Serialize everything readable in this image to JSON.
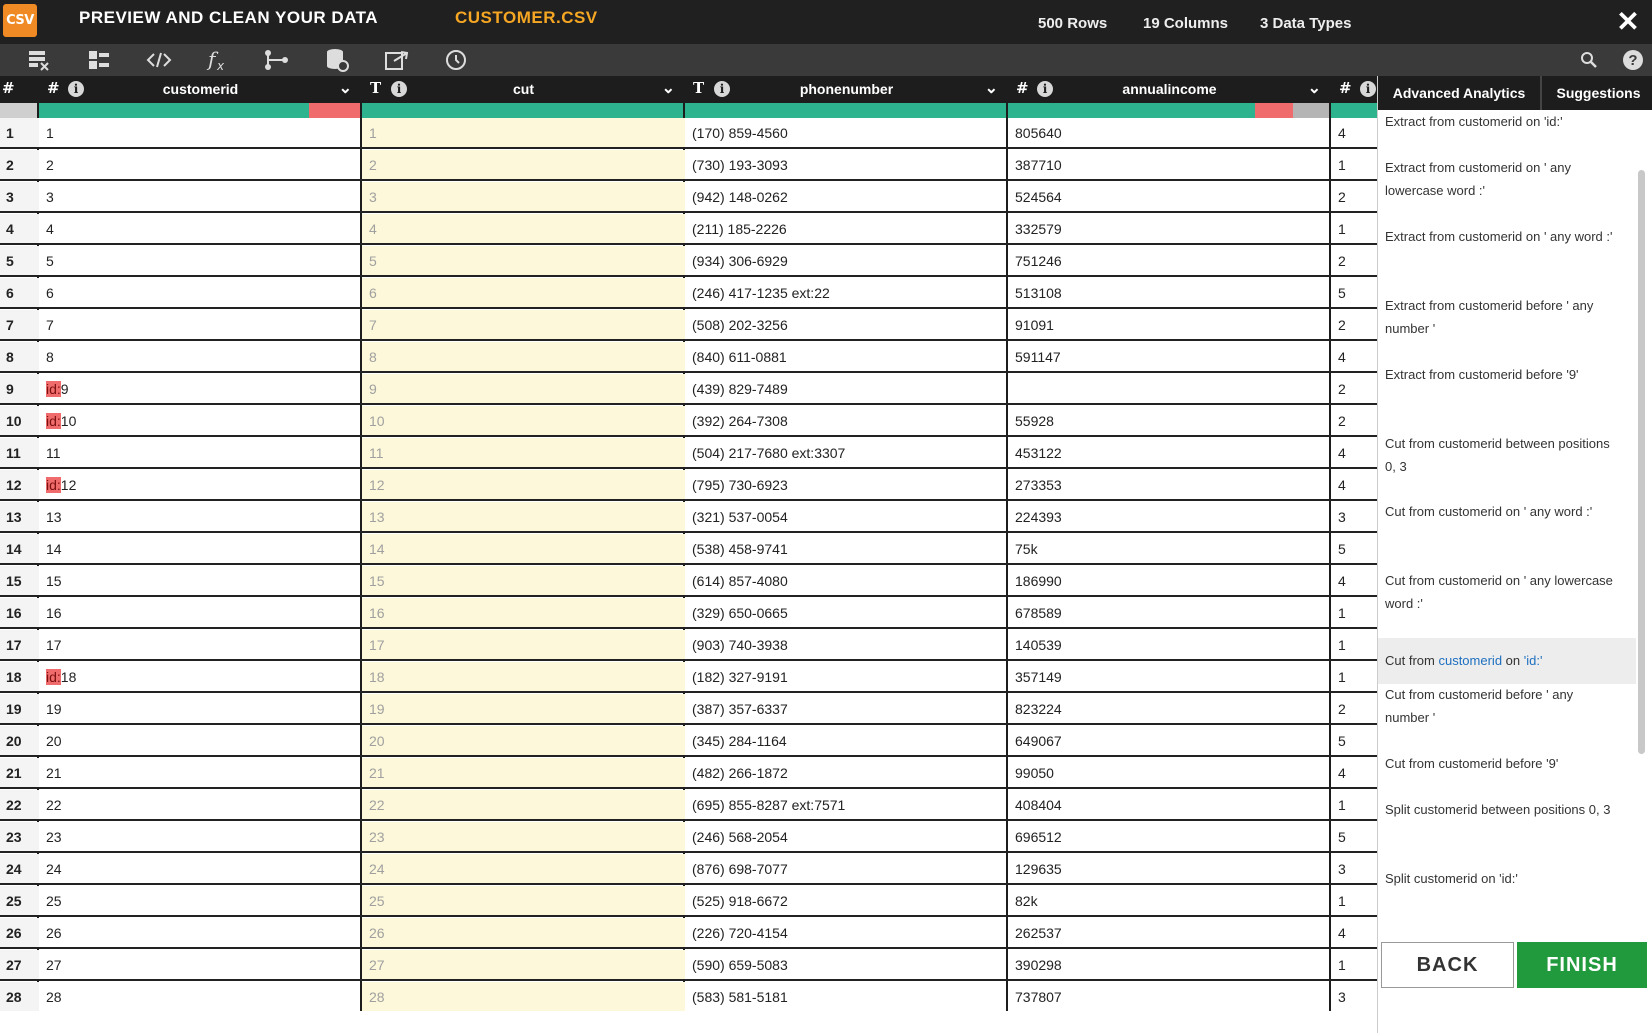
{
  "app": {
    "logo_text": "CSV",
    "title": "PREVIEW AND CLEAN YOUR DATA",
    "filename": "CUSTOMER.CSV",
    "stats": {
      "rows": "500 Rows",
      "columns": "19 Columns",
      "types": "3 Data Types"
    },
    "close_glyph": "✕"
  },
  "toolbar": {
    "icons": [
      "delete-columns-icon",
      "reorder-columns-icon",
      "code-icon",
      "formula-icon",
      "branch-icon",
      "database-icon",
      "export-icon",
      "history-icon",
      "search-icon",
      "help-icon"
    ]
  },
  "grid": {
    "rownum_header": "#",
    "columns": [
      {
        "type": "#",
        "name": "customerid",
        "info": "i",
        "chevron": "⌄"
      },
      {
        "type": "T",
        "name": "cut",
        "info": "i",
        "chevron": "⌄"
      },
      {
        "type": "T",
        "name": "phonenumber",
        "info": "i",
        "chevron": "⌄"
      },
      {
        "type": "#",
        "name": "annualincome",
        "info": "i",
        "chevron": "⌄"
      },
      {
        "type": "#",
        "name": "",
        "info": "i",
        "chevron": ""
      }
    ],
    "rows": [
      {
        "n": "1",
        "customerid": "1",
        "cut": "1",
        "phone": "(170) 859-4560",
        "income": "805640",
        "last": "4"
      },
      {
        "n": "2",
        "customerid": "2",
        "cut": "2",
        "phone": "(730) 193-3093",
        "income": "387710",
        "last": "1"
      },
      {
        "n": "3",
        "customerid": "3",
        "cut": "3",
        "phone": "(942) 148-0262",
        "income": "524564",
        "last": "2"
      },
      {
        "n": "4",
        "customerid": "4",
        "cut": "4",
        "phone": "(211) 185-2226",
        "income": "332579",
        "last": "1"
      },
      {
        "n": "5",
        "customerid": "5",
        "cut": "5",
        "phone": "(934) 306-6929",
        "income": "751246",
        "last": "2"
      },
      {
        "n": "6",
        "customerid": "6",
        "cut": "6",
        "phone": "(246) 417-1235 ext:22",
        "income": "513108",
        "last": "5"
      },
      {
        "n": "7",
        "customerid": "7",
        "cut": "7",
        "phone": "(508) 202-3256",
        "income": "91091",
        "last": "2"
      },
      {
        "n": "8",
        "customerid": "8",
        "cut": "8",
        "phone": "(840) 611-0881",
        "income": "591147",
        "last": "4"
      },
      {
        "n": "9",
        "customerid_tag": "id:",
        "customerid": "9",
        "cut": "9",
        "phone": "(439) 829-7489",
        "income": "",
        "last": "2"
      },
      {
        "n": "10",
        "customerid_tag": "id:",
        "customerid": "10",
        "cut": "10",
        "phone": "(392) 264-7308",
        "income": "55928",
        "last": "2"
      },
      {
        "n": "11",
        "customerid": "11",
        "cut": "11",
        "phone": "(504) 217-7680 ext:3307",
        "income": "453122",
        "last": "4"
      },
      {
        "n": "12",
        "customerid_tag": "id:",
        "customerid": "12",
        "cut": "12",
        "phone": "(795) 730-6923",
        "income": "273353",
        "last": "4"
      },
      {
        "n": "13",
        "customerid": "13",
        "cut": "13",
        "phone": "(321) 537-0054",
        "income": "224393",
        "last": "3"
      },
      {
        "n": "14",
        "customerid": "14",
        "cut": "14",
        "phone": "(538) 458-9741",
        "income": "75k",
        "last": "5"
      },
      {
        "n": "15",
        "customerid": "15",
        "cut": "15",
        "phone": "(614) 857-4080",
        "income": "186990",
        "last": "4"
      },
      {
        "n": "16",
        "customerid": "16",
        "cut": "16",
        "phone": "(329) 650-0665",
        "income": "678589",
        "last": "1"
      },
      {
        "n": "17",
        "customerid": "17",
        "cut": "17",
        "phone": "(903) 740-3938",
        "income": "140539",
        "last": "1"
      },
      {
        "n": "18",
        "customerid_tag": "id:",
        "customerid": "18",
        "cut": "18",
        "phone": "(182) 327-9191",
        "income": "357149",
        "last": "1"
      },
      {
        "n": "19",
        "customerid": "19",
        "cut": "19",
        "phone": "(387) 357-6337",
        "income": "823224",
        "last": "2"
      },
      {
        "n": "20",
        "customerid": "20",
        "cut": "20",
        "phone": "(345) 284-1164",
        "income": "649067",
        "last": "5"
      },
      {
        "n": "21",
        "customerid": "21",
        "cut": "21",
        "phone": "(482) 266-1872",
        "income": "99050",
        "last": "4"
      },
      {
        "n": "22",
        "customerid": "22",
        "cut": "22",
        "phone": "(695) 855-8287 ext:7571",
        "income": "408404",
        "last": "1"
      },
      {
        "n": "23",
        "customerid": "23",
        "cut": "23",
        "phone": "(246) 568-2054",
        "income": "696512",
        "last": "5"
      },
      {
        "n": "24",
        "customerid": "24",
        "cut": "24",
        "phone": "(876) 698-7077",
        "income": "129635",
        "last": "3"
      },
      {
        "n": "25",
        "customerid": "25",
        "cut": "25",
        "phone": "(525) 918-6672",
        "income": "82k",
        "last": "1"
      },
      {
        "n": "26",
        "customerid": "26",
        "cut": "26",
        "phone": "(226) 720-4154",
        "income": "262537",
        "last": "4"
      },
      {
        "n": "27",
        "customerid": "27",
        "cut": "27",
        "phone": "(590) 659-5083",
        "income": "390298",
        "last": "1"
      },
      {
        "n": "28",
        "customerid": "28",
        "cut": "28",
        "phone": "(583) 581-5181",
        "income": "737807",
        "last": "3"
      }
    ]
  },
  "panel": {
    "tabs": [
      "Advanced Analytics",
      "Suggestions"
    ],
    "suggestions": [
      {
        "text": "Extract from customerid on 'id:'"
      },
      {
        "text": "Extract from customerid on ' any lowercase word :'"
      },
      {
        "text": "Extract from customerid on ' any word :'"
      },
      {
        "text": "Extract from customerid before ' any number '"
      },
      {
        "text": "Extract from customerid before '9'"
      },
      {
        "text": "Cut from customerid between positions 0, 3"
      },
      {
        "text": "Cut from customerid on ' any word :'"
      },
      {
        "text": "Cut from customerid on ' any lowercase word :'"
      },
      {
        "text": "Cut from customerid on 'id:'",
        "selected": true,
        "parts": [
          "Cut from ",
          "customerid",
          " on ",
          "'id:'"
        ]
      },
      {
        "text": "Cut from customerid before ' any number '"
      },
      {
        "text": "Cut from customerid before '9'"
      },
      {
        "text": "Split customerid between positions 0, 3"
      },
      {
        "text": "Split customerid on 'id:'"
      }
    ],
    "back_label": "BACK",
    "finish_label": "FINISH"
  },
  "colors": {
    "topbar": "#202020",
    "accent_file": "#f5a623",
    "quality_ok": "#2db48f",
    "quality_bad": "#f06b6b",
    "finish": "#21993d",
    "link": "#1e6fc0"
  }
}
